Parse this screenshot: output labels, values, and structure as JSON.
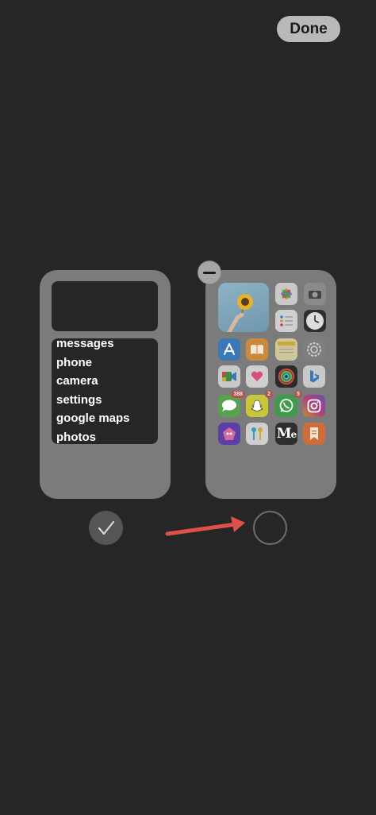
{
  "header": {
    "done_label": "Done"
  },
  "page_left": {
    "list_widget": [
      "messages",
      "phone",
      "camera",
      "settings",
      "google maps",
      "photos"
    ],
    "selected": true
  },
  "page_right": {
    "selected": false,
    "apps": [
      {
        "name": "photos-app-icon",
        "badge": ""
      },
      {
        "name": "camera-app-icon",
        "badge": ""
      },
      {
        "name": "reminders-app-icon",
        "badge": ""
      },
      {
        "name": "clock-app-icon",
        "badge": ""
      },
      {
        "name": "app-store-icon",
        "badge": ""
      },
      {
        "name": "books-app-icon",
        "badge": ""
      },
      {
        "name": "notes-app-icon",
        "badge": ""
      },
      {
        "name": "settings-app-icon",
        "badge": ""
      },
      {
        "name": "google-meet-app-icon",
        "badge": ""
      },
      {
        "name": "health-app-icon",
        "badge": ""
      },
      {
        "name": "fitness-app-icon",
        "badge": ""
      },
      {
        "name": "bing-app-icon",
        "badge": ""
      },
      {
        "name": "messages-app-icon",
        "badge": "388"
      },
      {
        "name": "snapchat-app-icon",
        "badge": "2"
      },
      {
        "name": "whatsapp-app-icon",
        "badge": "5"
      },
      {
        "name": "instagram-app-icon",
        "badge": ""
      },
      {
        "name": "game-app-icon",
        "badge": ""
      },
      {
        "name": "keys-app-icon",
        "badge": ""
      },
      {
        "name": "medium-app-icon",
        "badge": ""
      },
      {
        "name": "bookmark-app-icon",
        "badge": ""
      }
    ],
    "medium_glyph": "M",
    "medium_glyph_suffix": "e"
  },
  "colors": {
    "background": "#262626",
    "arrow": "#e0504a"
  }
}
